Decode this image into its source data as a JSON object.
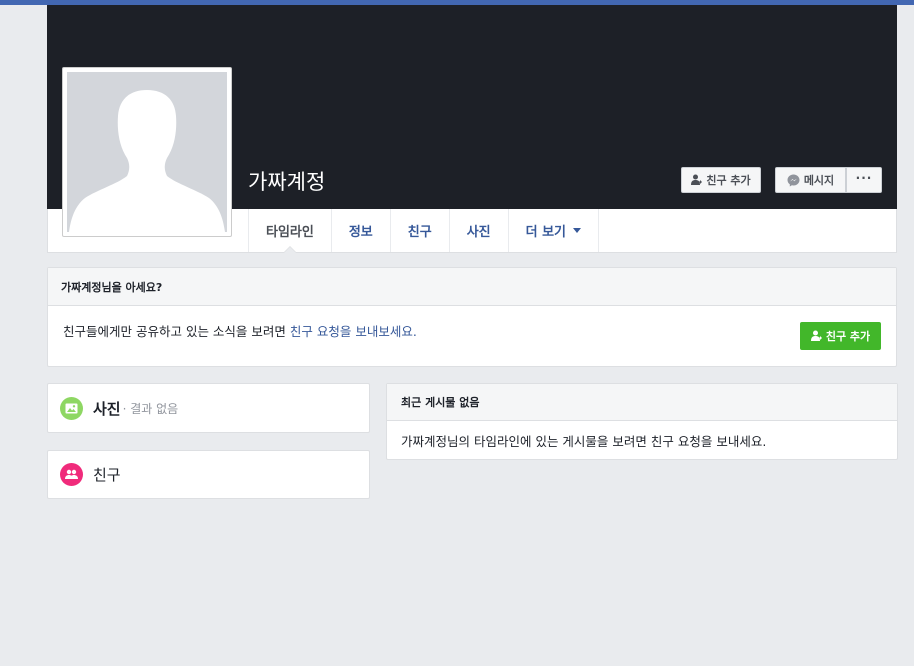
{
  "profile": {
    "name": "가짜계정",
    "add_friend_label": "친구 추가",
    "message_label": "메시지",
    "more_label": "···"
  },
  "nav": {
    "tabs": [
      {
        "label": "타임라인"
      },
      {
        "label": "정보"
      },
      {
        "label": "친구"
      },
      {
        "label": "사진"
      },
      {
        "label": "더 보기"
      }
    ]
  },
  "know_card": {
    "heading": "가짜계정님을 아세요?",
    "text_before": "친구들에게만 공유하고 있는 소식을 보려면 ",
    "link_text": "친구 요청을 보내보세요.",
    "button_label": "친구 추가"
  },
  "photos": {
    "title": "사진",
    "subtitle": "· 결과 없음"
  },
  "friends": {
    "title": "친구"
  },
  "posts": {
    "heading": "최근 게시물 없음",
    "body": "가짜계정님의 타임라인에 있는 게시물을 보려면 친구 요청을 보내세요."
  },
  "colors": {
    "top_bar": "#4267b2",
    "cover": "#1d2027",
    "link": "#365899",
    "green_button": "#42b72a",
    "photo_icon": "#8ed763",
    "friends_icon": "#f02b7b"
  }
}
